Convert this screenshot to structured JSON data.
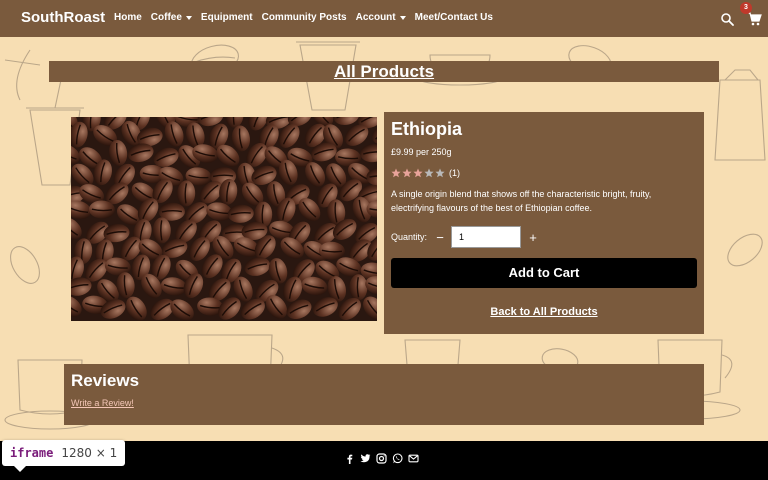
{
  "brand": "SouthRoast",
  "nav": {
    "items": [
      {
        "label": "Home",
        "dropdown": false
      },
      {
        "label": "Coffee",
        "dropdown": true
      },
      {
        "label": "Equipment",
        "dropdown": false
      },
      {
        "label": "Community Posts",
        "dropdown": false
      },
      {
        "label": "Account",
        "dropdown": true
      },
      {
        "label": "Meet/Contact Us",
        "dropdown": false
      }
    ],
    "cart_count": "3"
  },
  "page_title": "All Products",
  "product": {
    "name": "Ethiopia",
    "price": "£9.99 per 250g",
    "rating": 3,
    "rating_max": 5,
    "rating_count": "(1)",
    "description": "A single origin blend that shows off the characteristic bright, fruity, electrifying flavours of the best of Ethiopian coffee.",
    "quantity_label": "Quantity:",
    "quantity_value": "1",
    "add_to_cart": "Add to Cart",
    "back_link": "Back to All Products",
    "image_icon": "coffee-beans-photo"
  },
  "reviews": {
    "title": "Reviews",
    "write_review": "Write a Review!"
  },
  "footer": {
    "social_icons": [
      "facebook-icon",
      "twitter-icon",
      "instagram-icon",
      "whatsapp-icon",
      "email-icon"
    ]
  },
  "devtools": {
    "tag": "iframe",
    "size": "1280 × 1"
  },
  "colors": {
    "navbar": "#7a5a3d",
    "background": "#f7deb3",
    "button": "#000000",
    "star_filled": "#e8a39a",
    "star_empty": "#b9b9b9",
    "badge": "#c0392b"
  }
}
